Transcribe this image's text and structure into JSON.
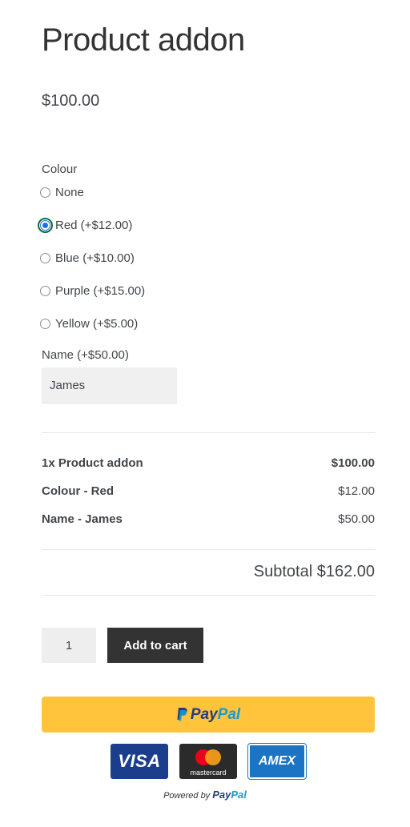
{
  "product": {
    "title": "Product addon",
    "price": "$100.00"
  },
  "addons": {
    "colour_label": "Colour",
    "colour_options": [
      {
        "label": "None",
        "checked": false
      },
      {
        "label": "Red (+$12.00)",
        "checked": true
      },
      {
        "label": "Blue (+$10.00)",
        "checked": false
      },
      {
        "label": "Purple (+$15.00)",
        "checked": false
      },
      {
        "label": "Yellow (+$5.00)",
        "checked": false
      }
    ],
    "name_label": "Name (+$50.00)",
    "name_value": "James"
  },
  "summary": {
    "rows": [
      {
        "label": "1x Product addon",
        "value": "$100.00"
      },
      {
        "label": "Colour - Red",
        "value": "$12.00"
      },
      {
        "label": "Name - James",
        "value": "$50.00"
      }
    ],
    "subtotal": "Subtotal $162.00"
  },
  "cart": {
    "quantity": "1",
    "add_to_cart_label": "Add to cart"
  },
  "payment": {
    "paypal_pay": "Pay",
    "paypal_pal": "Pal",
    "cards": {
      "visa": "VISA",
      "mastercard": "mastercard",
      "amex": "AMEX"
    },
    "powered_by": "Powered by",
    "powered_pay": "Pay",
    "powered_pal": "Pal"
  },
  "colors": {
    "paypal_yellow": "#ffc43b",
    "button_dark": "#333333",
    "radio_blue": "#1a73e8"
  }
}
